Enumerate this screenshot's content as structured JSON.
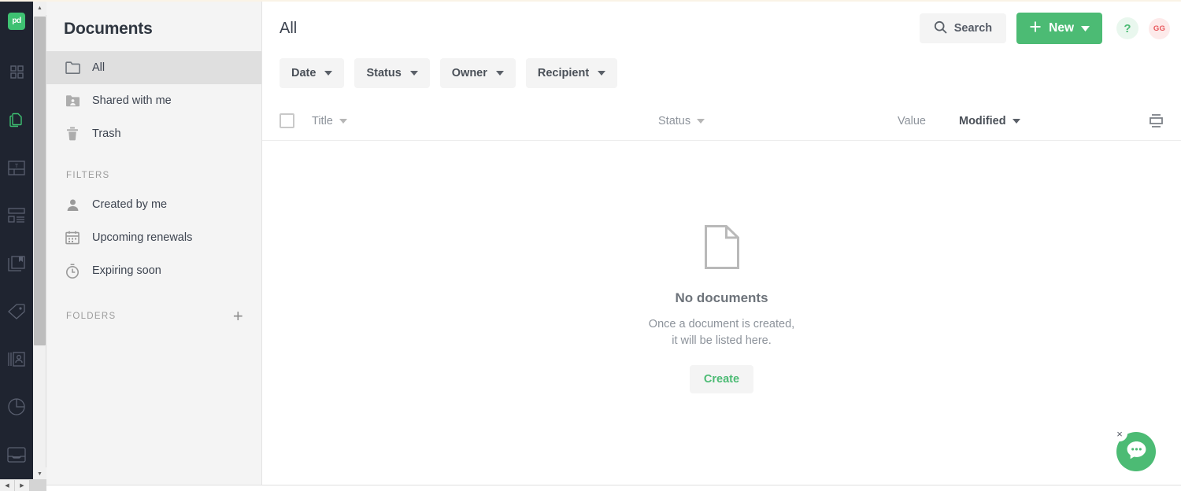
{
  "app": {
    "logo_text": "pd",
    "accent_green": "#4cbb74",
    "rail_bg": "#1f2430"
  },
  "rail": {
    "items": [
      {
        "name": "dashboard-icon",
        "label": "Dashboard"
      },
      {
        "name": "documents-icon",
        "label": "Documents"
      },
      {
        "name": "templates-icon",
        "label": "Templates"
      },
      {
        "name": "content-library-icon",
        "label": "Content library"
      },
      {
        "name": "catalog-icon",
        "label": "Catalog"
      },
      {
        "name": "pricing-tag-icon",
        "label": "Products"
      },
      {
        "name": "contacts-icon",
        "label": "Contacts"
      },
      {
        "name": "reports-icon",
        "label": "Reports"
      },
      {
        "name": "inbox-icon",
        "label": "Inbox"
      }
    ]
  },
  "sidebar": {
    "title": "Documents",
    "nav": [
      {
        "label": "All",
        "icon": "folder-icon",
        "active": true
      },
      {
        "label": "Shared with me",
        "icon": "shared-folder-icon",
        "active": false
      },
      {
        "label": "Trash",
        "icon": "trash-icon",
        "active": false
      }
    ],
    "filters_heading": "FILTERS",
    "filters": [
      {
        "label": "Created by me",
        "icon": "person-icon"
      },
      {
        "label": "Upcoming renewals",
        "icon": "calendar-icon"
      },
      {
        "label": "Expiring soon",
        "icon": "stopwatch-icon"
      }
    ],
    "folders_heading": "FOLDERS",
    "add_folder_label": "+"
  },
  "topbar": {
    "page_title": "All",
    "search_label": "Search",
    "new_label": "New",
    "help_label": "?",
    "avatar_initials": "GG"
  },
  "filter_chips": [
    {
      "label": "Date"
    },
    {
      "label": "Status"
    },
    {
      "label": "Owner"
    },
    {
      "label": "Recipient"
    }
  ],
  "table": {
    "columns": [
      {
        "label": "Title",
        "sortable": true,
        "active": false
      },
      {
        "label": "Status",
        "sortable": true,
        "active": false
      },
      {
        "label": "Value",
        "sortable": false,
        "active": false
      },
      {
        "label": "Modified",
        "sortable": true,
        "active": true
      }
    ],
    "rows": []
  },
  "empty_state": {
    "icon": "document-outline-icon",
    "title": "No documents",
    "line1": "Once a document is created,",
    "line2": "it will be listed here.",
    "button_label": "Create"
  },
  "chat": {
    "icon": "chat-bubble-icon",
    "close_label": "×"
  }
}
